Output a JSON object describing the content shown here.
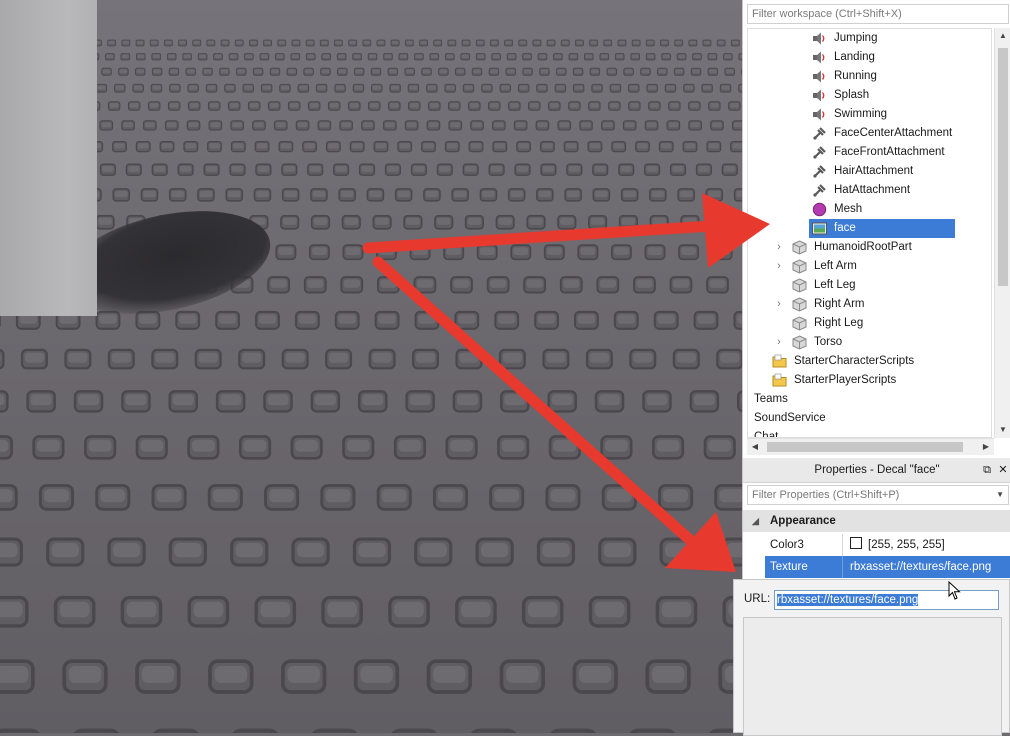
{
  "explorer": {
    "filter_placeholder": "Filter workspace (Ctrl+Shift+X)",
    "items": [
      {
        "label": "Jumping",
        "icon": "sound-icon",
        "indent": 2,
        "expandable": false
      },
      {
        "label": "Landing",
        "icon": "sound-icon",
        "indent": 2,
        "expandable": false
      },
      {
        "label": "Running",
        "icon": "sound-icon",
        "indent": 2,
        "expandable": false
      },
      {
        "label": "Splash",
        "icon": "sound-icon",
        "indent": 2,
        "expandable": false
      },
      {
        "label": "Swimming",
        "icon": "sound-icon",
        "indent": 2,
        "expandable": false
      },
      {
        "label": "FaceCenterAttachment",
        "icon": "attachment-icon",
        "indent": 2,
        "expandable": false
      },
      {
        "label": "FaceFrontAttachment",
        "icon": "attachment-icon",
        "indent": 2,
        "expandable": false
      },
      {
        "label": "HairAttachment",
        "icon": "attachment-icon",
        "indent": 2,
        "expandable": false
      },
      {
        "label": "HatAttachment",
        "icon": "attachment-icon",
        "indent": 2,
        "expandable": false
      },
      {
        "label": "Mesh",
        "icon": "mesh-icon",
        "indent": 2,
        "expandable": false
      },
      {
        "label": "face",
        "icon": "decal-icon",
        "indent": 2,
        "expandable": false,
        "selected": true
      },
      {
        "label": "HumanoidRootPart",
        "icon": "part-icon",
        "indent": 1,
        "expandable": true
      },
      {
        "label": "Left Arm",
        "icon": "part-icon",
        "indent": 1,
        "expandable": true
      },
      {
        "label": "Left Leg",
        "icon": "part-icon",
        "indent": 1,
        "expandable": false
      },
      {
        "label": "Right Arm",
        "icon": "part-icon",
        "indent": 1,
        "expandable": true
      },
      {
        "label": "Right Leg",
        "icon": "part-icon",
        "indent": 1,
        "expandable": false
      },
      {
        "label": "Torso",
        "icon": "part-icon",
        "indent": 1,
        "expandable": true
      },
      {
        "label": "StarterCharacterScripts",
        "icon": "folder-icon",
        "indent": 0,
        "expandable": false
      },
      {
        "label": "StarterPlayerScripts",
        "icon": "folder-icon",
        "indent": 0,
        "expandable": false
      },
      {
        "label": "Teams",
        "icon": "",
        "indent": 0,
        "expandable": false
      },
      {
        "label": "SoundService",
        "icon": "",
        "indent": 0,
        "expandable": false
      },
      {
        "label": "Chat",
        "icon": "",
        "indent": 0,
        "expandable": false
      }
    ]
  },
  "properties": {
    "title": "Properties - Decal \"face\"",
    "filter_placeholder": "Filter Properties (Ctrl+Shift+P)",
    "section": "Appearance",
    "rows": [
      {
        "name": "Color3",
        "value": "[255, 255, 255]"
      },
      {
        "name": "Texture",
        "value": "rbxasset://textures/face.png"
      }
    ]
  },
  "url_popup": {
    "label": "URL:",
    "value": "rbxasset://textures/face.png"
  },
  "colors": {
    "selection": "#3d7cd6",
    "annotation_arrow": "#e8392e"
  }
}
